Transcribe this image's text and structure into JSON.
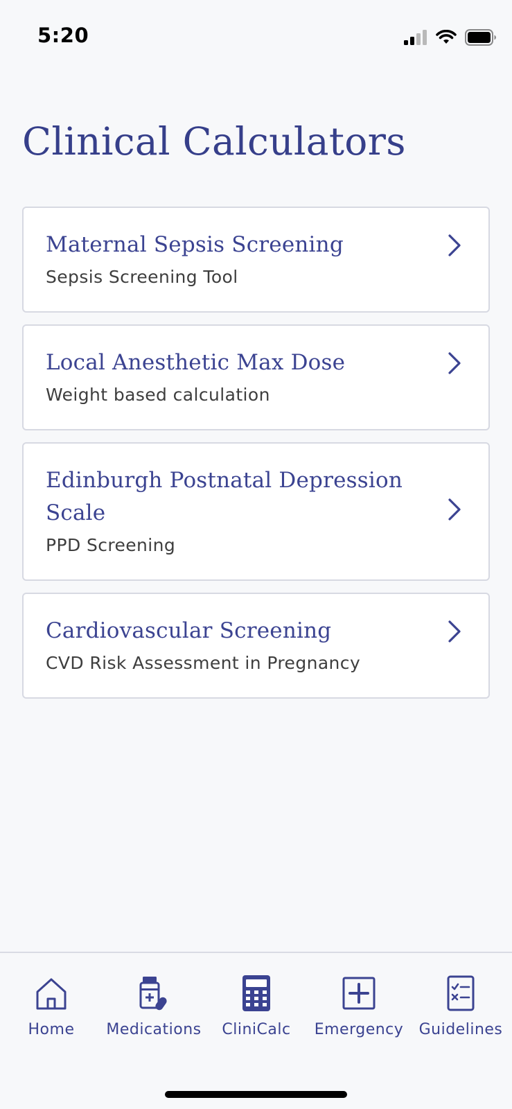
{
  "status_bar": {
    "time": "5:20"
  },
  "header": {
    "title": "Clinical Calculators"
  },
  "calculators": [
    {
      "title": "Maternal Sepsis Screening",
      "subtitle": "Sepsis Screening Tool"
    },
    {
      "title": "Local Anesthetic Max Dose",
      "subtitle": "Weight based calculation"
    },
    {
      "title": "Edinburgh Postnatal Depression Scale",
      "subtitle": "PPD Screening"
    },
    {
      "title": "Cardiovascular Screening",
      "subtitle": "CVD Risk Assessment in Pregnancy"
    }
  ],
  "tab_bar": {
    "active": "CliniCalc",
    "tabs": [
      {
        "label": "Home",
        "icon": "home-icon"
      },
      {
        "label": "Medications",
        "icon": "medications-icon"
      },
      {
        "label": "CliniCalc",
        "icon": "calculator-icon"
      },
      {
        "label": "Emergency",
        "icon": "emergency-plus-icon"
      },
      {
        "label": "Guidelines",
        "icon": "checklist-icon"
      }
    ]
  },
  "colors": {
    "accent": "#3b4391",
    "background": "#f7f8fa",
    "card_border": "#d7d9e2"
  }
}
